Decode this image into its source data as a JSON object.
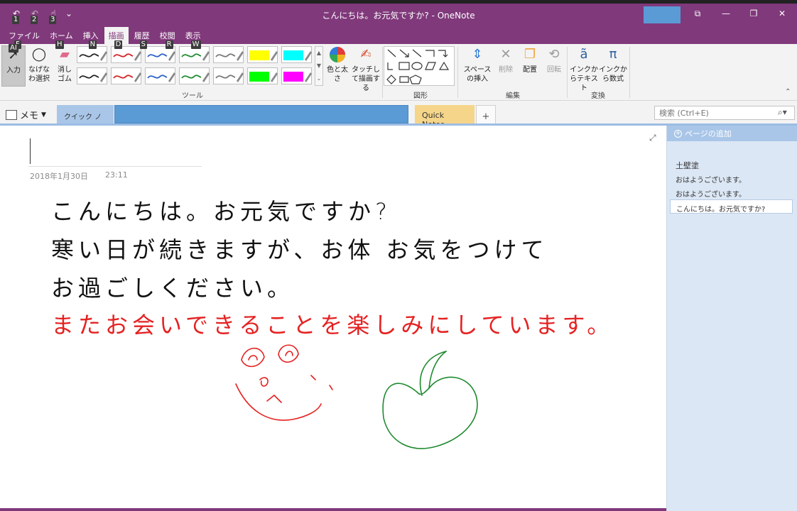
{
  "window": {
    "title": "こんにちは。お元気ですか? - OneNote"
  },
  "qat": {
    "items": [
      {
        "icon": "back-icon",
        "glyph": "↶",
        "keytip": "1"
      },
      {
        "icon": "undo-icon",
        "glyph": "↶",
        "keytip": "2"
      },
      {
        "icon": "touch-mode-icon",
        "glyph": "☝",
        "keytip": "3"
      },
      {
        "icon": "customize-icon",
        "glyph": "⌄",
        "keytip": ""
      }
    ]
  },
  "tabs": [
    {
      "label": "ファイル",
      "keytip": "F",
      "active": false
    },
    {
      "label": "ホーム",
      "keytip": "H",
      "active": false
    },
    {
      "label": "挿入",
      "keytip": "N",
      "active": false
    },
    {
      "label": "描画",
      "keytip": "D",
      "active": true
    },
    {
      "label": "履歴",
      "keytip": "S",
      "active": false
    },
    {
      "label": "校閲",
      "keytip": "R",
      "active": false
    },
    {
      "label": "表示",
      "keytip": "W",
      "active": false
    }
  ],
  "ribbon": {
    "input": "入力",
    "lasso": "なげなわ選択",
    "eraser": "消しゴム",
    "color_thickness": "色と太さ",
    "touch_draw": "タッチして描画する",
    "insert_space": "スペースの挿入",
    "delete": "削除",
    "arrange": "配置",
    "rotate": "回転",
    "ink_to_text": "インクからテキスト",
    "ink_to_math": "インクから数式",
    "groups": {
      "tools": "ツール",
      "shapes": "図形",
      "edit": "編集",
      "convert": "変換"
    },
    "pens": [
      {
        "color": "#222222",
        "highlight": false
      },
      {
        "color": "#d42020",
        "highlight": false
      },
      {
        "color": "#2a5fc9",
        "highlight": false
      },
      {
        "color": "#1e8a2e",
        "highlight": false
      },
      {
        "color": "#777777",
        "highlight": false
      },
      {
        "color": "#ffff00",
        "highlight": true
      },
      {
        "color": "#00ffff",
        "highlight": true
      },
      {
        "color": "#222222",
        "highlight": false
      },
      {
        "color": "#d42020",
        "highlight": false
      },
      {
        "color": "#2a5fc9",
        "highlight": false
      },
      {
        "color": "#1e8a2e",
        "highlight": false
      },
      {
        "color": "#777777",
        "highlight": false
      },
      {
        "color": "#00ff00",
        "highlight": true
      },
      {
        "color": "#ff00ff",
        "highlight": true
      }
    ]
  },
  "notebook": {
    "name": "メモ",
    "active_section": "クイック ノート",
    "quick_notes": "Quick Notes",
    "add_section": "+",
    "search_placeholder": "検索 (Ctrl+E)"
  },
  "page": {
    "date": "2018年1月30日",
    "time": "23:11",
    "ink_lines": [
      "こんにちは。お元気ですか?",
      "寒い日が続きますが、お体 お気をつけて",
      "お過ごしください。",
      "またお会いできることを楽しみにしています。"
    ]
  },
  "pagelist": {
    "add_page": "ページの追加",
    "pages": [
      {
        "title": "土壁塗",
        "type": "head"
      },
      {
        "title": "おはようございます。",
        "type": "normal"
      },
      {
        "title": "おはようございます。",
        "type": "normal"
      },
      {
        "title": "こんにちは。お元気ですか?",
        "type": "selected"
      }
    ]
  },
  "colors": {
    "brand": "#80397b",
    "ink_black": "#111111",
    "ink_red": "#e52222",
    "ink_green": "#1e8a2e"
  }
}
